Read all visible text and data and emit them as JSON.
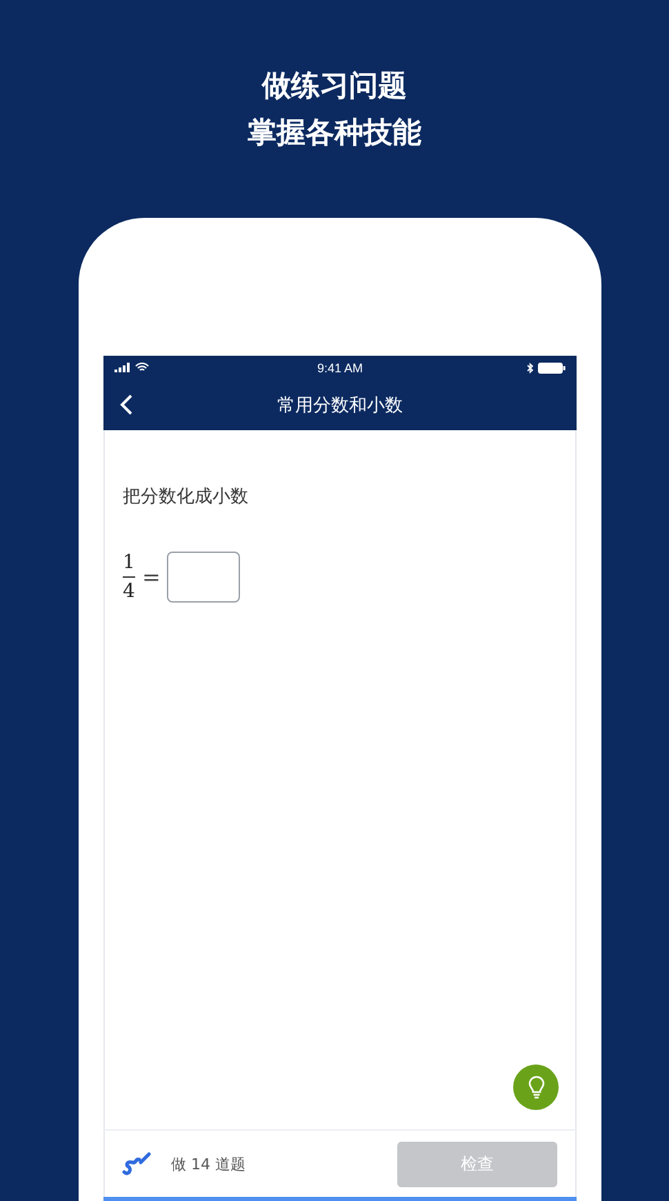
{
  "headline": [
    "做练习问题",
    "掌握各种技能"
  ],
  "status_bar": {
    "time": "9:41 AM"
  },
  "nav_bar": {
    "title": "常用分数和小数"
  },
  "exercise": {
    "prompt": "把分数化成小数",
    "numerator": "1",
    "denominator": "4",
    "equals": "="
  },
  "footer": {
    "progress_text": "做 14 道题",
    "check_button": {
      "label": "检查",
      "disabled": true
    }
  }
}
